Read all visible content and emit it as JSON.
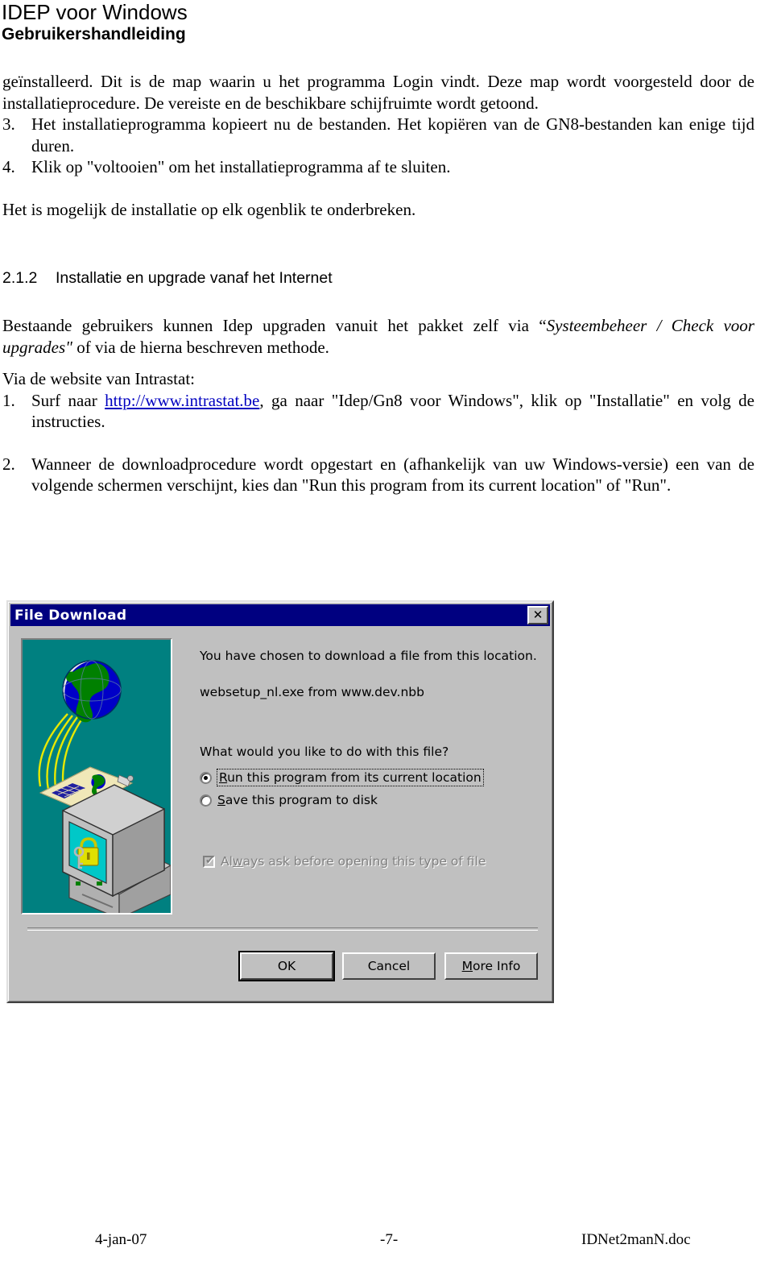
{
  "header": {
    "line1": "IDEP voor Windows",
    "line2": "Gebruikershandleiding"
  },
  "body": {
    "par_cont": "geïnstalleerd. Dit is de map waarin u het programma Login vindt. Deze map wordt voorgesteld door de installatieprocedure. De vereiste en de beschikbare schijfruimte wordt getoond.",
    "item3_num": "3.",
    "item3_text": "Het installatieprogramma kopieert nu de bestanden. Het kopiëren van de GN8-bestanden kan enige tijd duren.",
    "item4_num": "4.",
    "item4_text": "Klik op \"voltooien\" om het installatieprogramma af te sluiten.",
    "par_interrupt": "Het is mogelijk de installatie op elk ogenblik te onderbreken.",
    "heading_number": "2.1.2",
    "heading_title": "Installatie en upgrade vanaf het Internet",
    "upgrade_pre": "Bestaande gebruikers kunnen Idep upgraden vanuit het pakket zelf via ",
    "upgrade_quote_open": "“",
    "upgrade_italic": "Systeembeheer / Check voor upgrades\"",
    "upgrade_post": " of  via de hierna beschreven methode.",
    "via_website": "Via de website van Intrastat:",
    "item1_num": "1.",
    "item1_pre": "Surf naar ",
    "item1_link": "http://www.intrastat.be",
    "item1_post": ", ga naar \"Idep/Gn8 voor Windows\", klik op \"Installatie\" en volg de instructies.",
    "item2_num": "2.",
    "item2_text": "Wanneer de downloadprocedure wordt opgestart en (afhankelijk van uw Windows-versie) een van de volgende schermen verschijnt, kies dan \"Run this program from its current location\" of \"Run\"."
  },
  "dialog": {
    "title": "File Download",
    "close_glyph": "✕",
    "chosen_text": "You have chosen to download a file from this location.",
    "file_text": "websetup_nl.exe from www.dev.nbb",
    "question_text": "What would you like to do with this file?",
    "radio_run_accel": "R",
    "radio_run_rest": "un this program from its current location",
    "radio_save_accel": "S",
    "radio_save_rest": "ave this program to disk",
    "radio_selected": "run",
    "checkbox_pre": "Al",
    "checkbox_accel": "w",
    "checkbox_rest": "ays ask before opening this type of file",
    "checkbox_checked": true,
    "checkbox_tick": "✔",
    "checkbox_disabled": true,
    "buttons": {
      "ok": "OK",
      "cancel": "Cancel",
      "more_info_accel": "M",
      "more_info_rest": "ore Info"
    },
    "colors": {
      "titlebar": "#000080",
      "face": "#c0c0c0",
      "illustration_background": "#008080",
      "monitor_screen": "#00c0c0",
      "padlock": "#d8d800",
      "globe_land": "#008000",
      "globe_water": "#0000d0",
      "cable": "#e8e800"
    }
  },
  "footer": {
    "date": "4-jan-07",
    "page": "-7-",
    "filename": "IDNet2manN.doc"
  }
}
